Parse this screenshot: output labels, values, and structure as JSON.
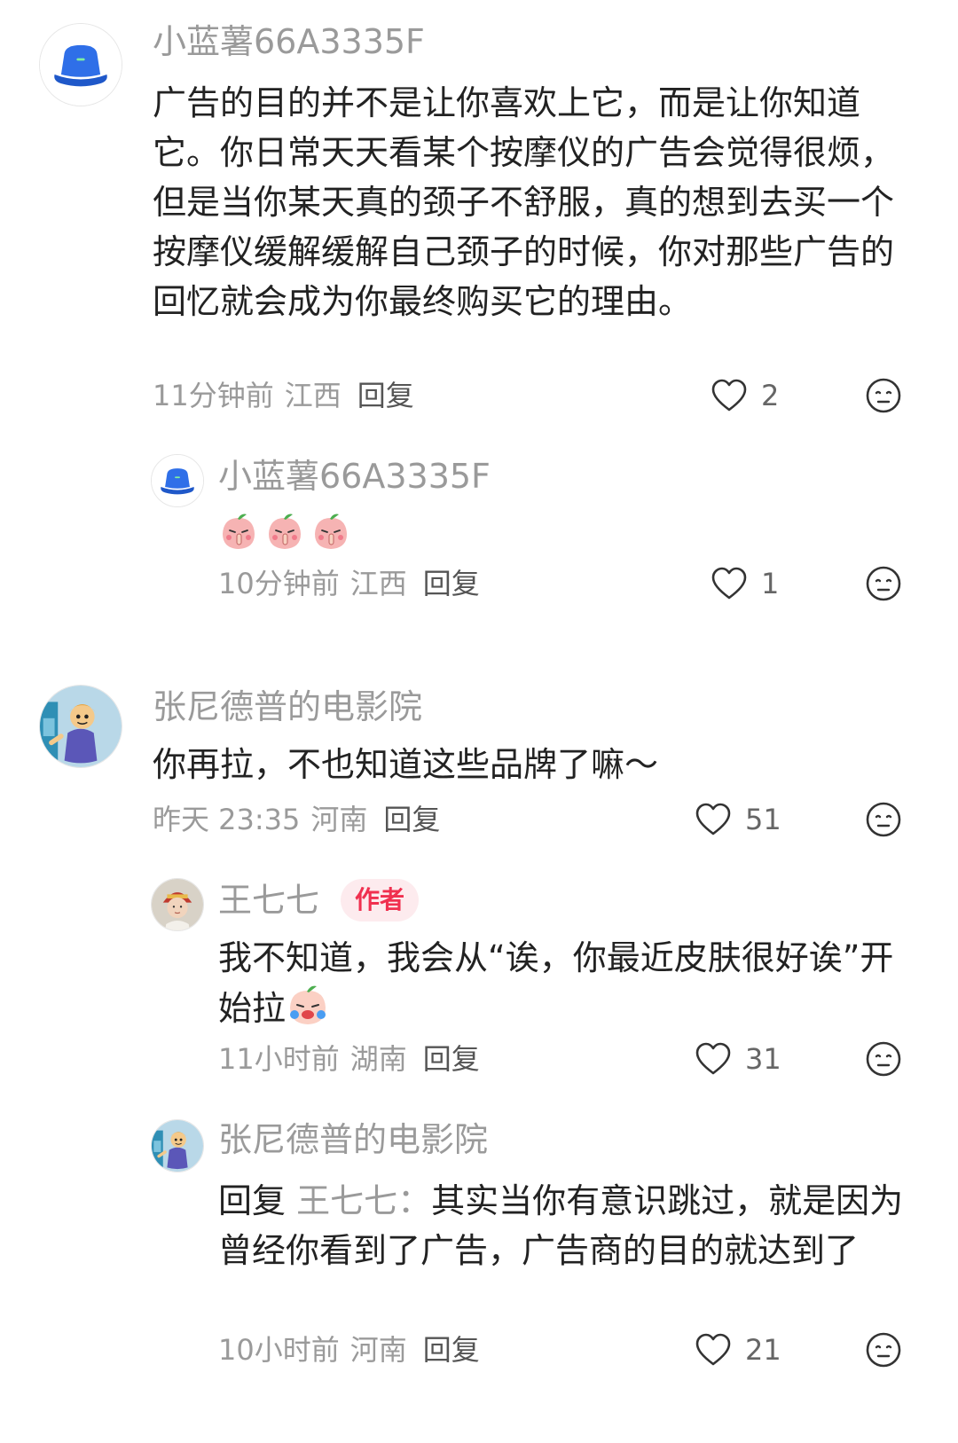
{
  "comments": [
    {
      "user": "小蓝薯66A3335F",
      "text": "广告的目的并不是让你喜欢上它，而是让你知道它。你日常天天看某个按摩仪的广告会觉得很烦，但是当你某天真的颈子不舒服，真的想到去买一个按摩仪缓解缓解自己颈子的时候，你对那些广告的回忆就会成为你最终购买它的理由。",
      "time": "11分钟前",
      "region": "江西",
      "reply_label": "回复",
      "likes": "2",
      "avatar_icon": "blue-bucket-hat-icon",
      "replies": [
        {
          "user": "小蓝薯66A3335F",
          "stickers": [
            "peach-shush-sticker",
            "peach-shush-sticker",
            "peach-shush-sticker"
          ],
          "time": "10分钟前",
          "region": "江西",
          "reply_label": "回复",
          "likes": "1",
          "avatar_icon": "blue-bucket-hat-icon"
        }
      ]
    },
    {
      "user": "张尼德普的电影院",
      "text": "你再拉，不也知道这些品牌了嘛～",
      "time": "昨天 23:35",
      "region": "河南",
      "reply_label": "回复",
      "likes": "51",
      "avatar_icon": "cartoon-character-avatar",
      "replies": [
        {
          "user": "王七七",
          "badge": "作者",
          "text": "我不知道，我会从“诶，你最近皮肤很好诶”开始拉",
          "inline_emoji": "peach-laugh-cry-emoji",
          "time": "11小时前",
          "region": "湖南",
          "reply_label": "回复",
          "likes": "31",
          "avatar_icon": "person-photo-avatar"
        },
        {
          "user": "张尼德普的电影院",
          "reply_prefix": "回复",
          "reply_target": "王七七：",
          "text": "其实当你有意识跳过，就是因为曾经你看到了广告，广告商的目的就达到了",
          "time": "10小时前",
          "region": "河南",
          "reply_label": "回复",
          "likes": "21",
          "avatar_icon": "cartoon-character-avatar"
        }
      ]
    }
  ],
  "colors": {
    "muted_text": "#9a9a9a",
    "body_text": "#222222",
    "author_badge_bg": "#fdebee",
    "author_badge_text": "#f0304f",
    "avatar_blue": "#2f6fe8"
  }
}
